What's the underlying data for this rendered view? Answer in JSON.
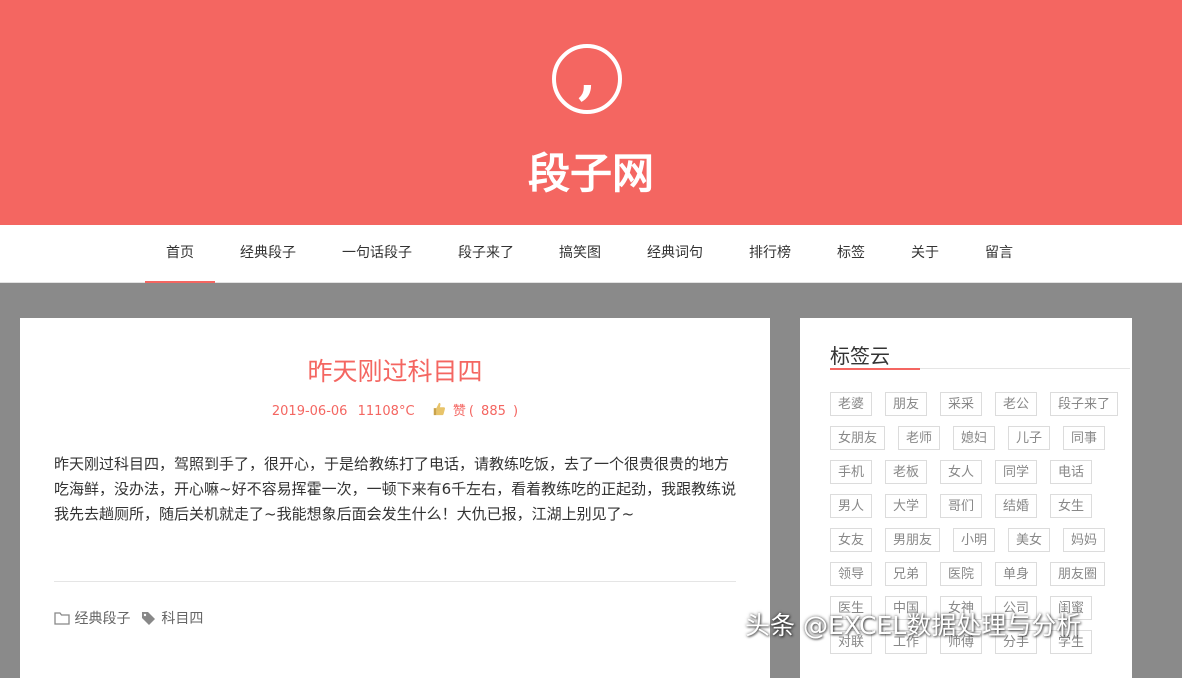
{
  "site": {
    "title": "段子网"
  },
  "nav": {
    "items": [
      "首页",
      "经典段子",
      "一句话段子",
      "段子来了",
      "搞笑图",
      "经典词句",
      "排行榜",
      "标签",
      "关于",
      "留言"
    ]
  },
  "post": {
    "title": "昨天刚过科目四",
    "date": "2019-06-06",
    "temp": "11108°C",
    "like_label": "赞",
    "like_count": "885",
    "body": "昨天刚过科目四，驾照到手了，很开心，于是给教练打了电话，请教练吃饭，去了一个很贵很贵的地方吃海鲜，没办法，开心嘛~好不容易挥霍一次，一顿下来有6千左右，看着教练吃的正起劲，我跟教练说我先去趟厕所，随后关机就走了~我能想象后面会发生什么！大仇已报，江湖上别见了~",
    "category": "经典段子",
    "tag": "科目四"
  },
  "sidebar": {
    "title": "标签云",
    "tags": [
      [
        "老婆",
        "朋友",
        "采采",
        "老公",
        "段子来了"
      ],
      [
        "女朋友",
        "老师",
        "媳妇",
        "儿子",
        "同事"
      ],
      [
        "手机",
        "老板",
        "女人",
        "同学",
        "电话"
      ],
      [
        "男人",
        "大学",
        "哥们",
        "结婚",
        "女生"
      ],
      [
        "女友",
        "男朋友",
        "小明",
        "美女",
        "妈妈"
      ],
      [
        "领导",
        "兄弟",
        "医院",
        "单身",
        "朋友圈"
      ],
      [
        "医生",
        "中国",
        "女神",
        "公司",
        "闺蜜"
      ],
      [
        "对联",
        "工作",
        "师傅",
        "分手",
        "学生"
      ]
    ]
  },
  "watermark": "头条 @EXCEL数据处理与分析",
  "colors": {
    "accent": "#f46661",
    "page_bg": "#8a8a8a"
  }
}
